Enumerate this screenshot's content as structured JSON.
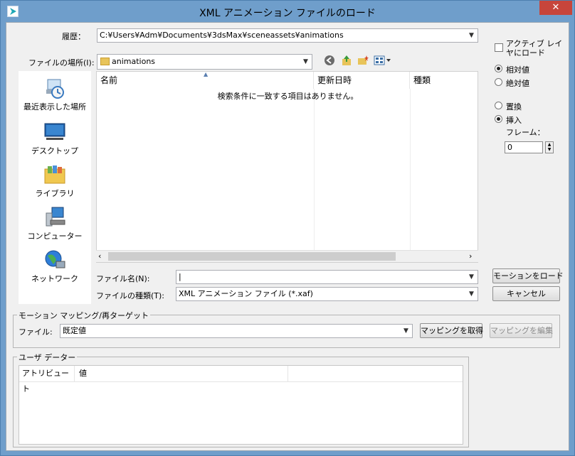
{
  "window": {
    "title": "XML アニメーション ファイルのロード",
    "close_glyph": "✕"
  },
  "history": {
    "label": "履歴：",
    "value": "C:¥Users¥Adm¥Documents¥3dsMax¥sceneassets¥animations"
  },
  "lookin": {
    "label": "ファイルの場所(I):",
    "value": "animations"
  },
  "places": [
    {
      "label": "最近表示した場所",
      "icon": "recent-places-icon"
    },
    {
      "label": "デスクトップ",
      "icon": "desktop-icon"
    },
    {
      "label": "ライブラリ",
      "icon": "libraries-icon"
    },
    {
      "label": "コンピューター",
      "icon": "computer-icon"
    },
    {
      "label": "ネットワーク",
      "icon": "network-icon"
    }
  ],
  "filelist": {
    "columns": [
      "名前",
      "更新日時",
      "種類"
    ],
    "empty_message": "検索条件に一致する項目はありません。"
  },
  "filename": {
    "label": "ファイル名(N):",
    "value": "|"
  },
  "filetype": {
    "label": "ファイルの種類(T):",
    "value": "XML アニメーション ファイル (*.xaf)"
  },
  "buttons": {
    "load": "モーションをロード",
    "cancel": "キャンセル"
  },
  "options": {
    "active_layer_line1": "アクティブ レイ",
    "active_layer_line2": "ヤにロード",
    "relative": "相対値",
    "absolute": "絶対値",
    "replace": "置換",
    "insert": "挿入",
    "frame_label": "フレーム：",
    "frame_value": "0",
    "relative_selected": true,
    "insert_selected": true
  },
  "mapping": {
    "group_title": "モーション マッピング/再ターゲット",
    "file_label": "ファイル:",
    "file_value": "既定値",
    "get_mapping": "マッピングを取得",
    "edit_mapping": "マッピングを編集"
  },
  "userdata": {
    "group_title": "ユーザ データー",
    "columns": [
      "アトリビュート",
      "値"
    ]
  }
}
